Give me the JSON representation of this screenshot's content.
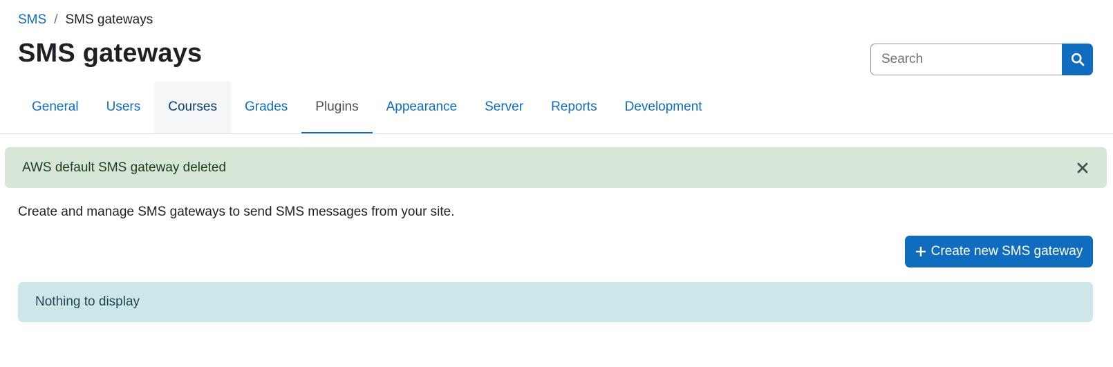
{
  "breadcrumb": {
    "link": "SMS",
    "separator": "/",
    "current": "SMS gateways"
  },
  "header": {
    "title": "SMS gateways"
  },
  "search": {
    "placeholder": "Search",
    "value": "",
    "button_icon": "search-icon"
  },
  "tabs": [
    {
      "label": "General"
    },
    {
      "label": "Users"
    },
    {
      "label": "Courses"
    },
    {
      "label": "Grades"
    },
    {
      "label": "Plugins"
    },
    {
      "label": "Appearance"
    },
    {
      "label": "Server"
    },
    {
      "label": "Reports"
    },
    {
      "label": "Development"
    }
  ],
  "active_tab": "Plugins",
  "notification": {
    "message": "AWS default SMS gateway deleted",
    "close_icon": "close-icon"
  },
  "main": {
    "description": "Create and manage SMS gateways to send SMS messages from your site.",
    "create_button": "Create new SMS gateway",
    "empty_message": "Nothing to display"
  },
  "colors": {
    "primary": "#0f6cbf",
    "success_bg": "#d7e6d7",
    "info_bg": "#cce6ea"
  }
}
